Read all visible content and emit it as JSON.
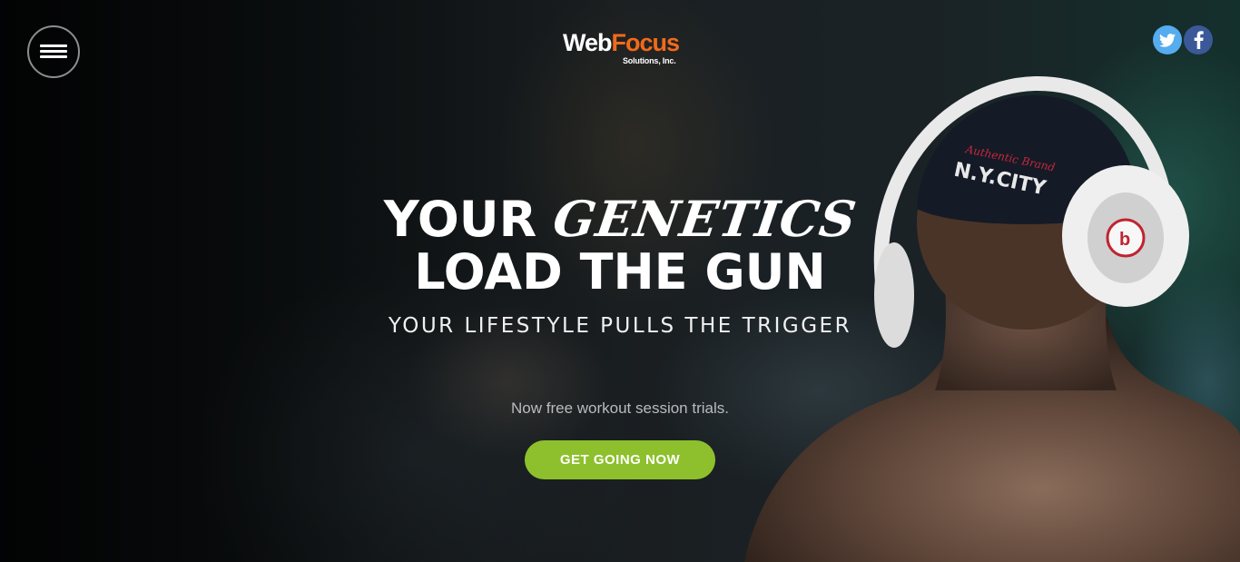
{
  "header": {
    "menu_icon": "hamburger-icon",
    "logo": {
      "primary_part1": "Web",
      "primary_part2": "Focus",
      "secondary": "Solutions, Inc."
    },
    "social": [
      {
        "name": "twitter-icon",
        "color": "#55acee"
      },
      {
        "name": "facebook-icon",
        "color": "#3b5998"
      }
    ]
  },
  "hero": {
    "headline_part1": "YOUR",
    "headline_emphasis": "GENETICS",
    "headline_line2": "LOAD THE GUN",
    "subheadline": "YOUR LIFESTYLE PULLS THE TRIGGER",
    "tagline": "Now free workout session trials.",
    "cta_label": "GET GOING NOW",
    "cap_text": "N.Y.CITY",
    "cap_script": "Authentic Brand",
    "headphone_logo": "b"
  },
  "colors": {
    "accent_green": "#8dc02c",
    "logo_orange": "#f26a1b"
  }
}
